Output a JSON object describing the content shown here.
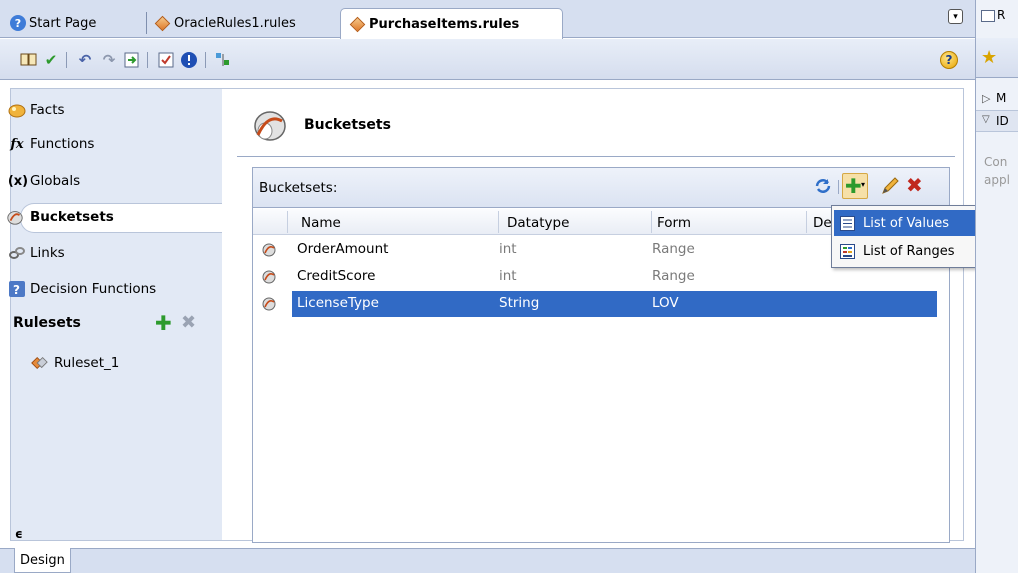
{
  "tabs": [
    {
      "label": "Start Page",
      "icon": "help-circle-icon"
    },
    {
      "label": "OracleRules1.rules",
      "icon": "diamond-icon"
    },
    {
      "label": "PurchaseItems.rules",
      "icon": "diamond-icon",
      "active": true
    }
  ],
  "toolbar": {
    "icons": [
      "dictionary-icon",
      "validate-check-icon",
      "undo-icon",
      "redo-icon",
      "export-icon",
      "test-icon",
      "info-icon",
      "compare-icon"
    ],
    "help_icon": "help-icon"
  },
  "sidebar": {
    "items": [
      {
        "label": "Facts",
        "icon": "facts-icon"
      },
      {
        "label": "Functions",
        "icon": "functions-icon",
        "glyph": "fx"
      },
      {
        "label": "Globals",
        "icon": "globals-icon",
        "glyph": "(x)"
      },
      {
        "label": "Bucketsets",
        "icon": "bucketsets-icon",
        "selected": true
      },
      {
        "label": "Links",
        "icon": "links-icon"
      },
      {
        "label": "Decision Functions",
        "icon": "decision-functions-icon"
      }
    ],
    "rulesets_label": "Rulesets",
    "rulesets": [
      {
        "label": "Ruleset_1",
        "icon": "ruleset-icon"
      }
    ],
    "collapse_glyph": "ϵ"
  },
  "main": {
    "title": "Bucketsets",
    "panel_label": "Bucketsets:",
    "columns": [
      "Name",
      "Datatype",
      "Form",
      "De"
    ],
    "rows": [
      {
        "name": "OrderAmount",
        "datatype": "int",
        "form": "Range"
      },
      {
        "name": "CreditScore",
        "datatype": "int",
        "form": "Range"
      },
      {
        "name": "LicenseType",
        "datatype": "String",
        "form": "LOV",
        "selected": true
      }
    ],
    "panel_actions": [
      "refresh-icon",
      "add-icon",
      "edit-icon",
      "delete-icon"
    ]
  },
  "menu": {
    "items": [
      {
        "label": "List of Values",
        "icon": "list-of-values-icon",
        "highlighted": true
      },
      {
        "label": "List of Ranges",
        "icon": "list-of-ranges-icon"
      }
    ]
  },
  "bottom": {
    "design_tab": "Design"
  },
  "right_panel": {
    "lines": [
      "R",
      "M",
      "ID",
      "Con",
      "appl"
    ]
  },
  "colors": {
    "tab_bg": "#d6dff0",
    "sidebar_bg": "#e2e9f5",
    "selection": "#316ac5",
    "border": "#9aa9c6"
  }
}
